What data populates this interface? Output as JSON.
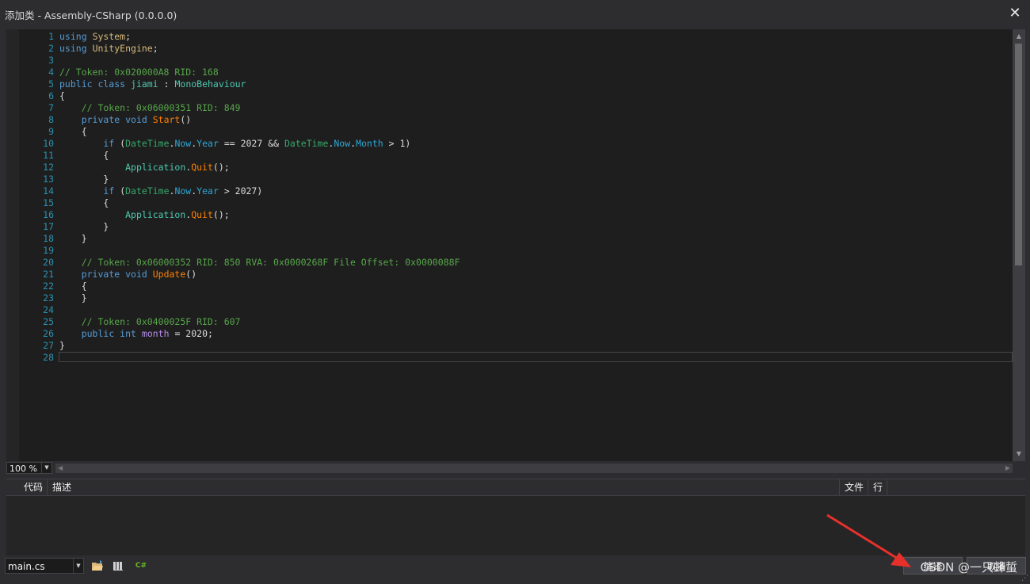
{
  "window": {
    "title": "添加类 - Assembly-CSharp (0.0.0.0)",
    "close_label": "✕"
  },
  "editor": {
    "line_numbers": [
      "1",
      "2",
      "3",
      "4",
      "5",
      "6",
      "7",
      "8",
      "9",
      "10",
      "11",
      "12",
      "13",
      "14",
      "15",
      "16",
      "17",
      "18",
      "19",
      "20",
      "21",
      "22",
      "23",
      "24",
      "25",
      "26",
      "27",
      "28"
    ],
    "zoom": "100 %"
  },
  "error_list": {
    "columns": [
      "代码",
      "描述",
      "文件",
      "行"
    ]
  },
  "bottom": {
    "file_selected": "main.cs",
    "compile_button": "编译",
    "cancel_button": "取消",
    "watermark": "CSDN @一只蜂蜇"
  },
  "icons": [
    "open-folder-icon",
    "references-icon",
    "csharp-icon",
    "close-icon",
    "resize-grip-icon"
  ],
  "colors": {
    "keyword": "#569cd6",
    "type": "#4ec9b0",
    "comment": "#57a64a",
    "method": "#ff8000",
    "line_number": "#2b91af",
    "arrow": "#e8302a"
  }
}
